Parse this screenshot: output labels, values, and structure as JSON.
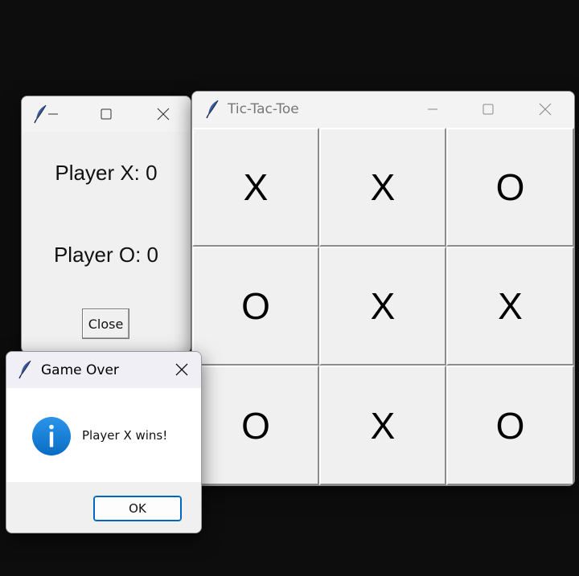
{
  "scores_window": {
    "player_x_label": "Player X: 0",
    "player_o_label": "Player O: 0",
    "close_button": "Close"
  },
  "game_window": {
    "title": "Tic-Tac-Toe",
    "board": [
      [
        "X",
        "X",
        "O"
      ],
      [
        "O",
        "X",
        "X"
      ],
      [
        "O",
        "X",
        "O"
      ]
    ]
  },
  "dialog": {
    "title": "Game Over",
    "icon": "info-icon",
    "message": "Player X wins!",
    "ok_button": "OK"
  },
  "colors": {
    "desktop": "#0d0d0d",
    "window_bg": "#f0f0f0",
    "info_icon": "#0a78d4",
    "accent": "#0067c0"
  }
}
